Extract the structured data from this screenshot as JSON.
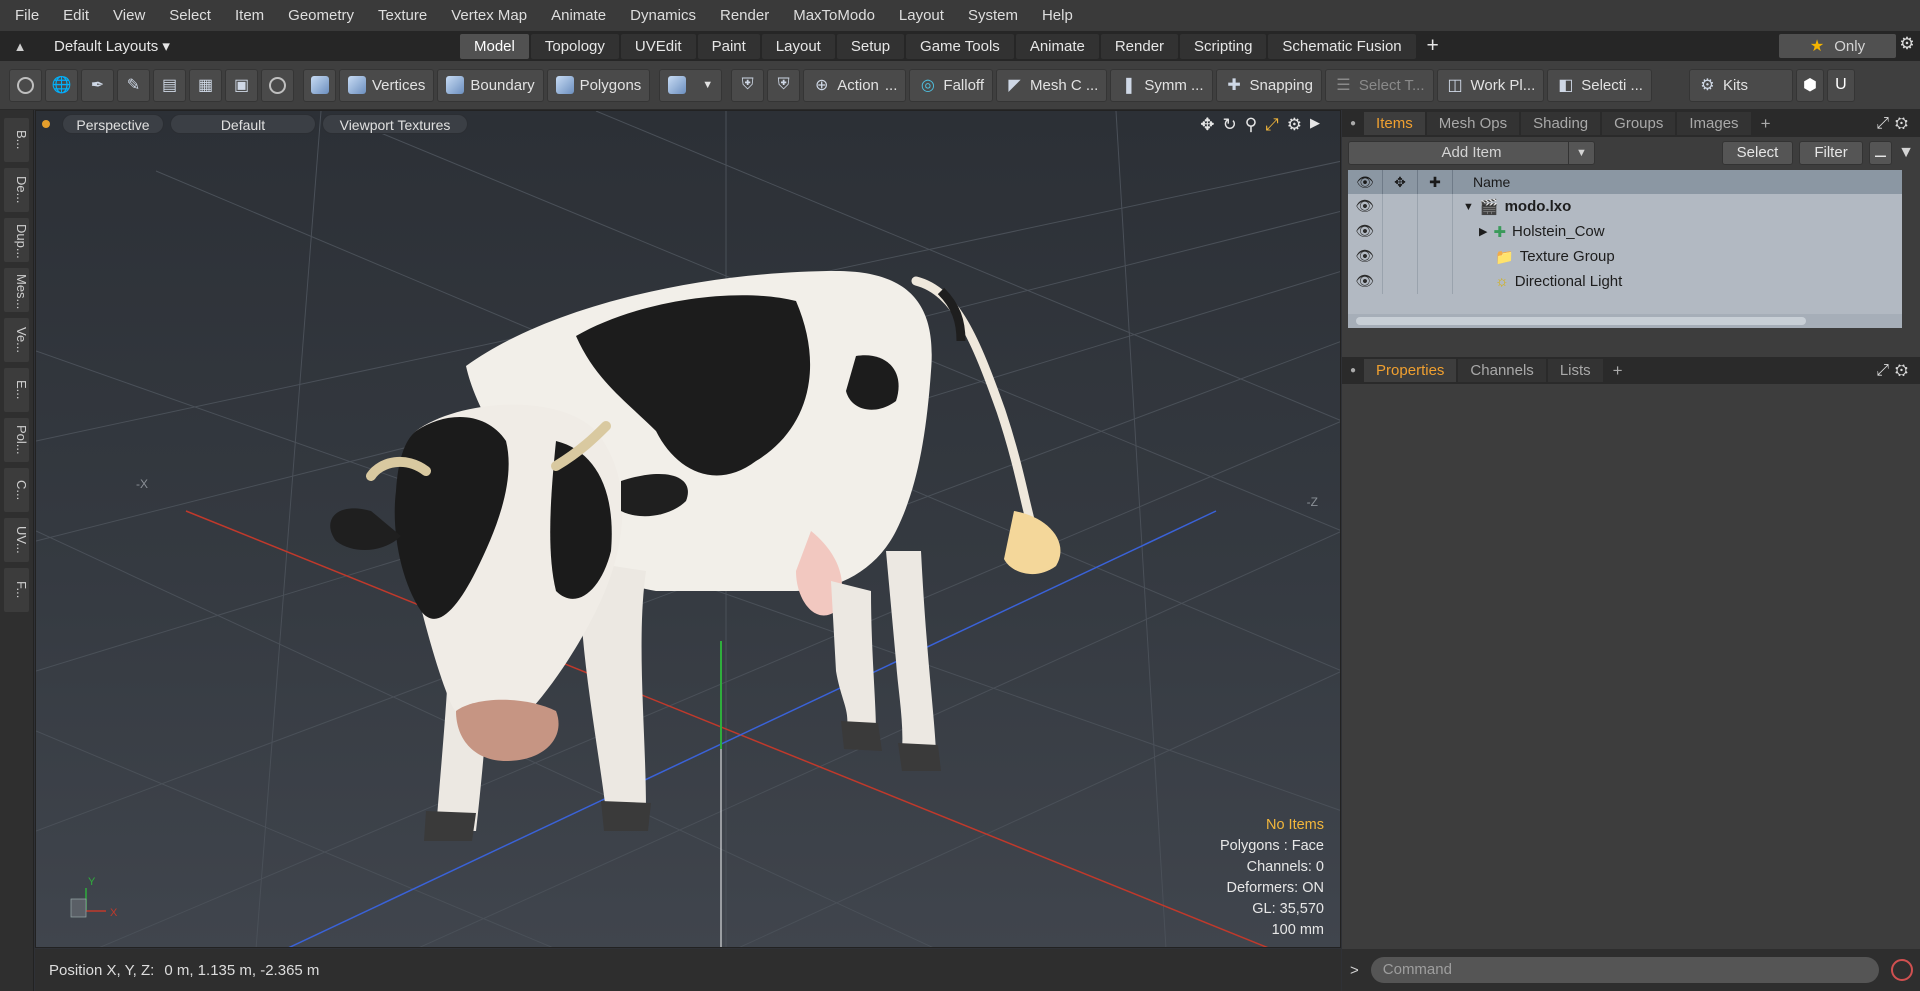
{
  "menubar": {
    "items": [
      "File",
      "Edit",
      "View",
      "Select",
      "Item",
      "Geometry",
      "Texture",
      "Vertex Map",
      "Animate",
      "Dynamics",
      "Render",
      "MaxToModo",
      "Layout",
      "System",
      "Help"
    ]
  },
  "layoutbar": {
    "layout_selector": "Default Layouts ▾",
    "tabs": [
      "Model",
      "Topology",
      "UVEdit",
      "Paint",
      "Layout",
      "Setup",
      "Game Tools",
      "Animate",
      "Render",
      "Scripting",
      "Schematic Fusion"
    ],
    "active_tab": "Model",
    "add": "+",
    "only": "Only"
  },
  "toolbar": {
    "vertices": "Vertices",
    "boundary": "Boundary",
    "polygons": "Polygons",
    "action": "Action",
    "action_more": "...",
    "falloff": "Falloff",
    "mesh": "Mesh C ...",
    "symmetry": "Symm ...",
    "snapping": "Snapping",
    "select_t": "Select T...",
    "workplane": "Work Pl...",
    "selection": "Selecti ...",
    "kits": "Kits"
  },
  "leftstrip": [
    "B...",
    "De...",
    "Dup...",
    "Mes...",
    "Ve...",
    "E...",
    "Pol...",
    "C...",
    "UV...",
    "F..."
  ],
  "viewport": {
    "view": "Perspective",
    "shading": "Default",
    "textures": "Viewport Textures",
    "axis_x": "-X",
    "axis_z": "-Z",
    "gizmo_y": "Y",
    "gizmo_x": "X",
    "hud": {
      "status": "No Items",
      "polygons": "Polygons : Face",
      "channels": "Channels: 0",
      "deformers": "Deformers: ON",
      "gl": "GL: 35,570",
      "scale": "100 mm"
    }
  },
  "statusbar": {
    "label": "Position X, Y, Z:",
    "value": "0 m, 1.135 m, -2.365 m"
  },
  "items_panel": {
    "tabs": [
      "Items",
      "Mesh Ops",
      "Shading",
      "Groups",
      "Images"
    ],
    "active": "Items",
    "add_item": "Add Item",
    "select": "Select",
    "filter": "Filter",
    "name_header": "Name",
    "tree": [
      {
        "label": "modo.lxo",
        "bold": true,
        "expander": "▼",
        "indent": 0,
        "icon": "scene-icon"
      },
      {
        "label": "Holstein_Cow",
        "expander": "▶",
        "indent": 1,
        "icon": "locator-icon"
      },
      {
        "label": "Texture Group",
        "expander": "",
        "indent": 1,
        "icon": "folder-icon"
      },
      {
        "label": "Directional Light",
        "expander": "",
        "indent": 1,
        "icon": "light-icon"
      }
    ]
  },
  "props_panel": {
    "tabs": [
      "Properties",
      "Channels",
      "Lists"
    ],
    "active": "Properties"
  },
  "command": {
    "placeholder": "Command",
    "prompt": ">"
  },
  "colors": {
    "accent": "#f0a030",
    "x_axis": "#c0392b",
    "y_axis": "#2fae3c",
    "z_axis": "#3a62d8"
  }
}
